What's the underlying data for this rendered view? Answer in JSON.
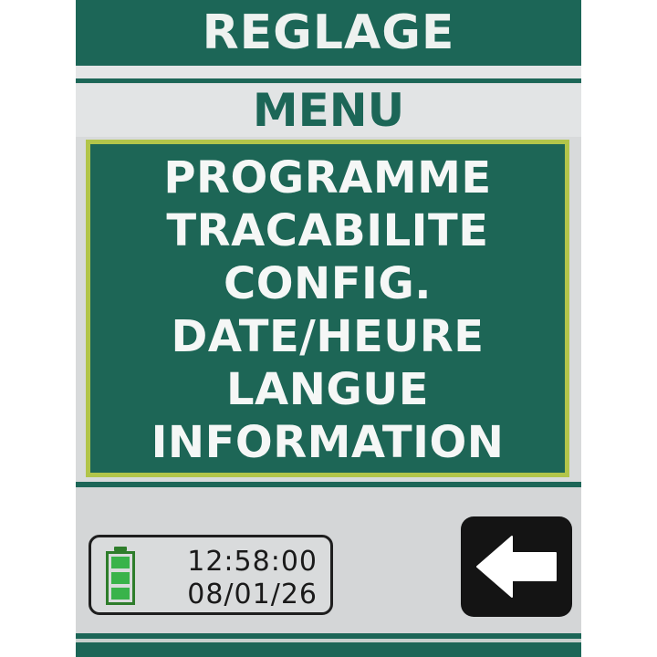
{
  "header": {
    "title": "REGLAGE"
  },
  "subtitle": "MENU",
  "menu": {
    "items": [
      {
        "label": "PROGRAMME"
      },
      {
        "label": "TRACABILITE"
      },
      {
        "label": "CONFIG."
      },
      {
        "label": "DATE/HEURE"
      },
      {
        "label": "LANGUE"
      },
      {
        "label": "INFORMATION"
      }
    ]
  },
  "status": {
    "time": "12:58:00",
    "date": "08/01/26",
    "battery_icon": "battery-full-icon",
    "battery_level": 1.0
  },
  "back_button": {
    "icon": "arrow-left-icon"
  },
  "colors": {
    "primary_green": "#1c6657",
    "menu_border": "#b2c54a",
    "battery_green": "#39b34a"
  }
}
